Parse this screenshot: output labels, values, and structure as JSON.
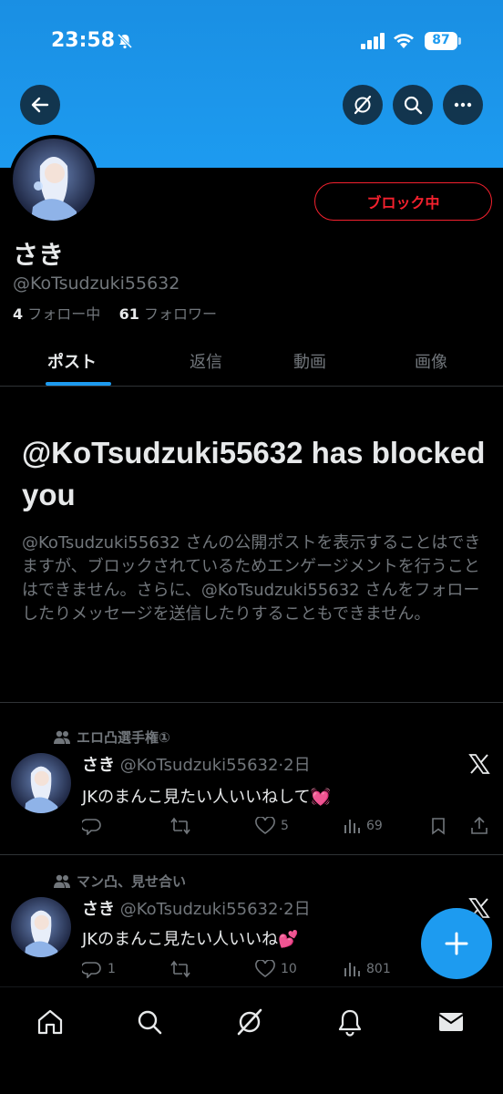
{
  "statusbar": {
    "time": "23:58",
    "battery": "87"
  },
  "profile": {
    "name": "さき",
    "handle": "@KoTsudzuki55632",
    "following_count": "4",
    "following_label": "フォロー中",
    "followers_count": "61",
    "followers_label": "フォロワー",
    "block_button": "ブロック中"
  },
  "tabs": [
    "ポスト",
    "返信",
    "動画",
    "画像"
  ],
  "blocked": {
    "title": "@KoTsudzuki55632 has blocked you",
    "description": "@KoTsudzuki55632 さんの公開ポストを表示することはできますが、ブロックされているためエンゲージメントを行うことはできません。さらに、@KoTsudzuki55632 さんをフォローしたりメッセージを送信したりすることもできません。"
  },
  "posts": [
    {
      "community": "エロ凸選手権①",
      "name": "さき",
      "meta": "@KoTsudzuki55632·2日",
      "text": "JKのまんこ見たい人いいねして💓",
      "likes": "5",
      "views": "69"
    },
    {
      "community": "マン凸、見せ合い",
      "name": "さき",
      "meta": "@KoTsudzuki55632·2日",
      "text": "JKのまんこ見たい人いいね💕",
      "replies": "1",
      "likes": "10",
      "views": "801"
    }
  ],
  "icons": {
    "back": "arrow-left-icon",
    "grok": "grok-icon",
    "search": "search-icon",
    "more": "more-icon",
    "nav": [
      "home-icon",
      "search-icon",
      "grok-icon",
      "bell-icon",
      "mail-icon"
    ]
  },
  "colors": {
    "accent": "#1d9bf0",
    "block_red": "#f4212e",
    "muted": "#71767b"
  }
}
